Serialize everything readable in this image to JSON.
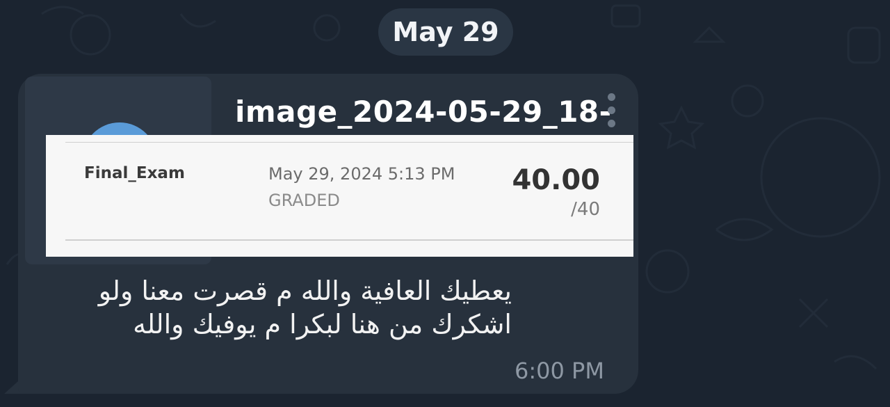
{
  "chat": {
    "date_separator": "May 29",
    "message": {
      "file_name": "image_2024-05-29_18-",
      "attachment_preview": {
        "item_name": "Final_Exam",
        "submitted": "May 29, 2024 5:13 PM",
        "status": "GRADED",
        "score": "40.00",
        "total": "/40"
      },
      "text_lines": [
        "يعطيك العافية والله م قصرت معنا ولو",
        "اشكرك من هنا لبكرا م يوفيك والله"
      ],
      "time": "6:00 PM"
    }
  },
  "colors": {
    "background": "#1b2430",
    "bubble": "#27313d",
    "pill": "#2a3644",
    "avatar": "#5a9bd8"
  },
  "icons": [
    "kebab-menu-icon"
  ]
}
